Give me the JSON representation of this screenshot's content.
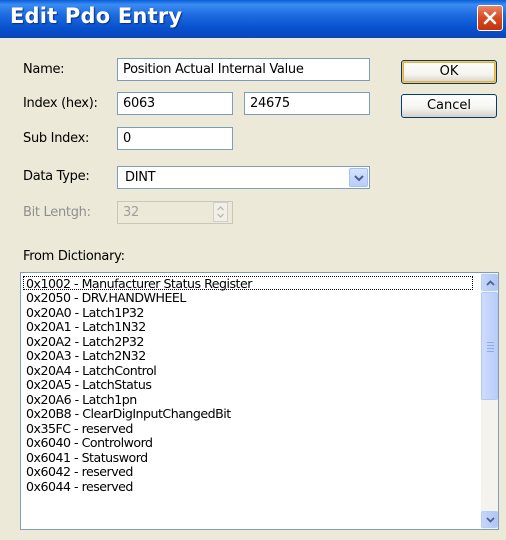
{
  "window": {
    "title": "Edit Pdo Entry"
  },
  "form": {
    "name_label": "Name:",
    "name_value": "Position Actual Internal Value",
    "index_label": "Index (hex):",
    "index_hex_value": "6063",
    "index_dec_value": "24675",
    "subindex_label": "Sub Index:",
    "subindex_value": "0",
    "datatype_label": "Data Type:",
    "datatype_value": "DINT",
    "bitlength_label": "Bit Lentgh:",
    "bitlength_value": "32"
  },
  "buttons": {
    "ok_label": "OK",
    "cancel_label": "Cancel"
  },
  "dictionary": {
    "label": "From Dictionary:",
    "items": [
      "0x1002 - Manufacturer Status Register",
      "0x2050 - DRV.HANDWHEEL",
      "0x20A0 - Latch1P32",
      "0x20A1 - Latch1N32",
      "0x20A2 - Latch2P32",
      "0x20A3 - Latch2N32",
      "0x20A4 - LatchControl",
      "0x20A5 - LatchStatus",
      "0x20A6 - Latch1pn",
      "0x20B8 - ClearDigInputChangedBit",
      "0x35FC - reserved",
      "0x6040 - Controlword",
      "0x6041 - Statusword",
      "0x6042 - reserved",
      "0x6044 - reserved"
    ]
  },
  "icons": {
    "close": "close-icon",
    "dropdown": "chevron-down-icon",
    "spin": "spin-arrows-icon",
    "scroll_up": "scroll-up-icon",
    "scroll_down": "scroll-down-icon"
  },
  "colors": {
    "titlebar": "#0750cd",
    "close": "#d84a1f",
    "dialog_bg": "#ece9d8",
    "field_border": "#7f9db9"
  }
}
